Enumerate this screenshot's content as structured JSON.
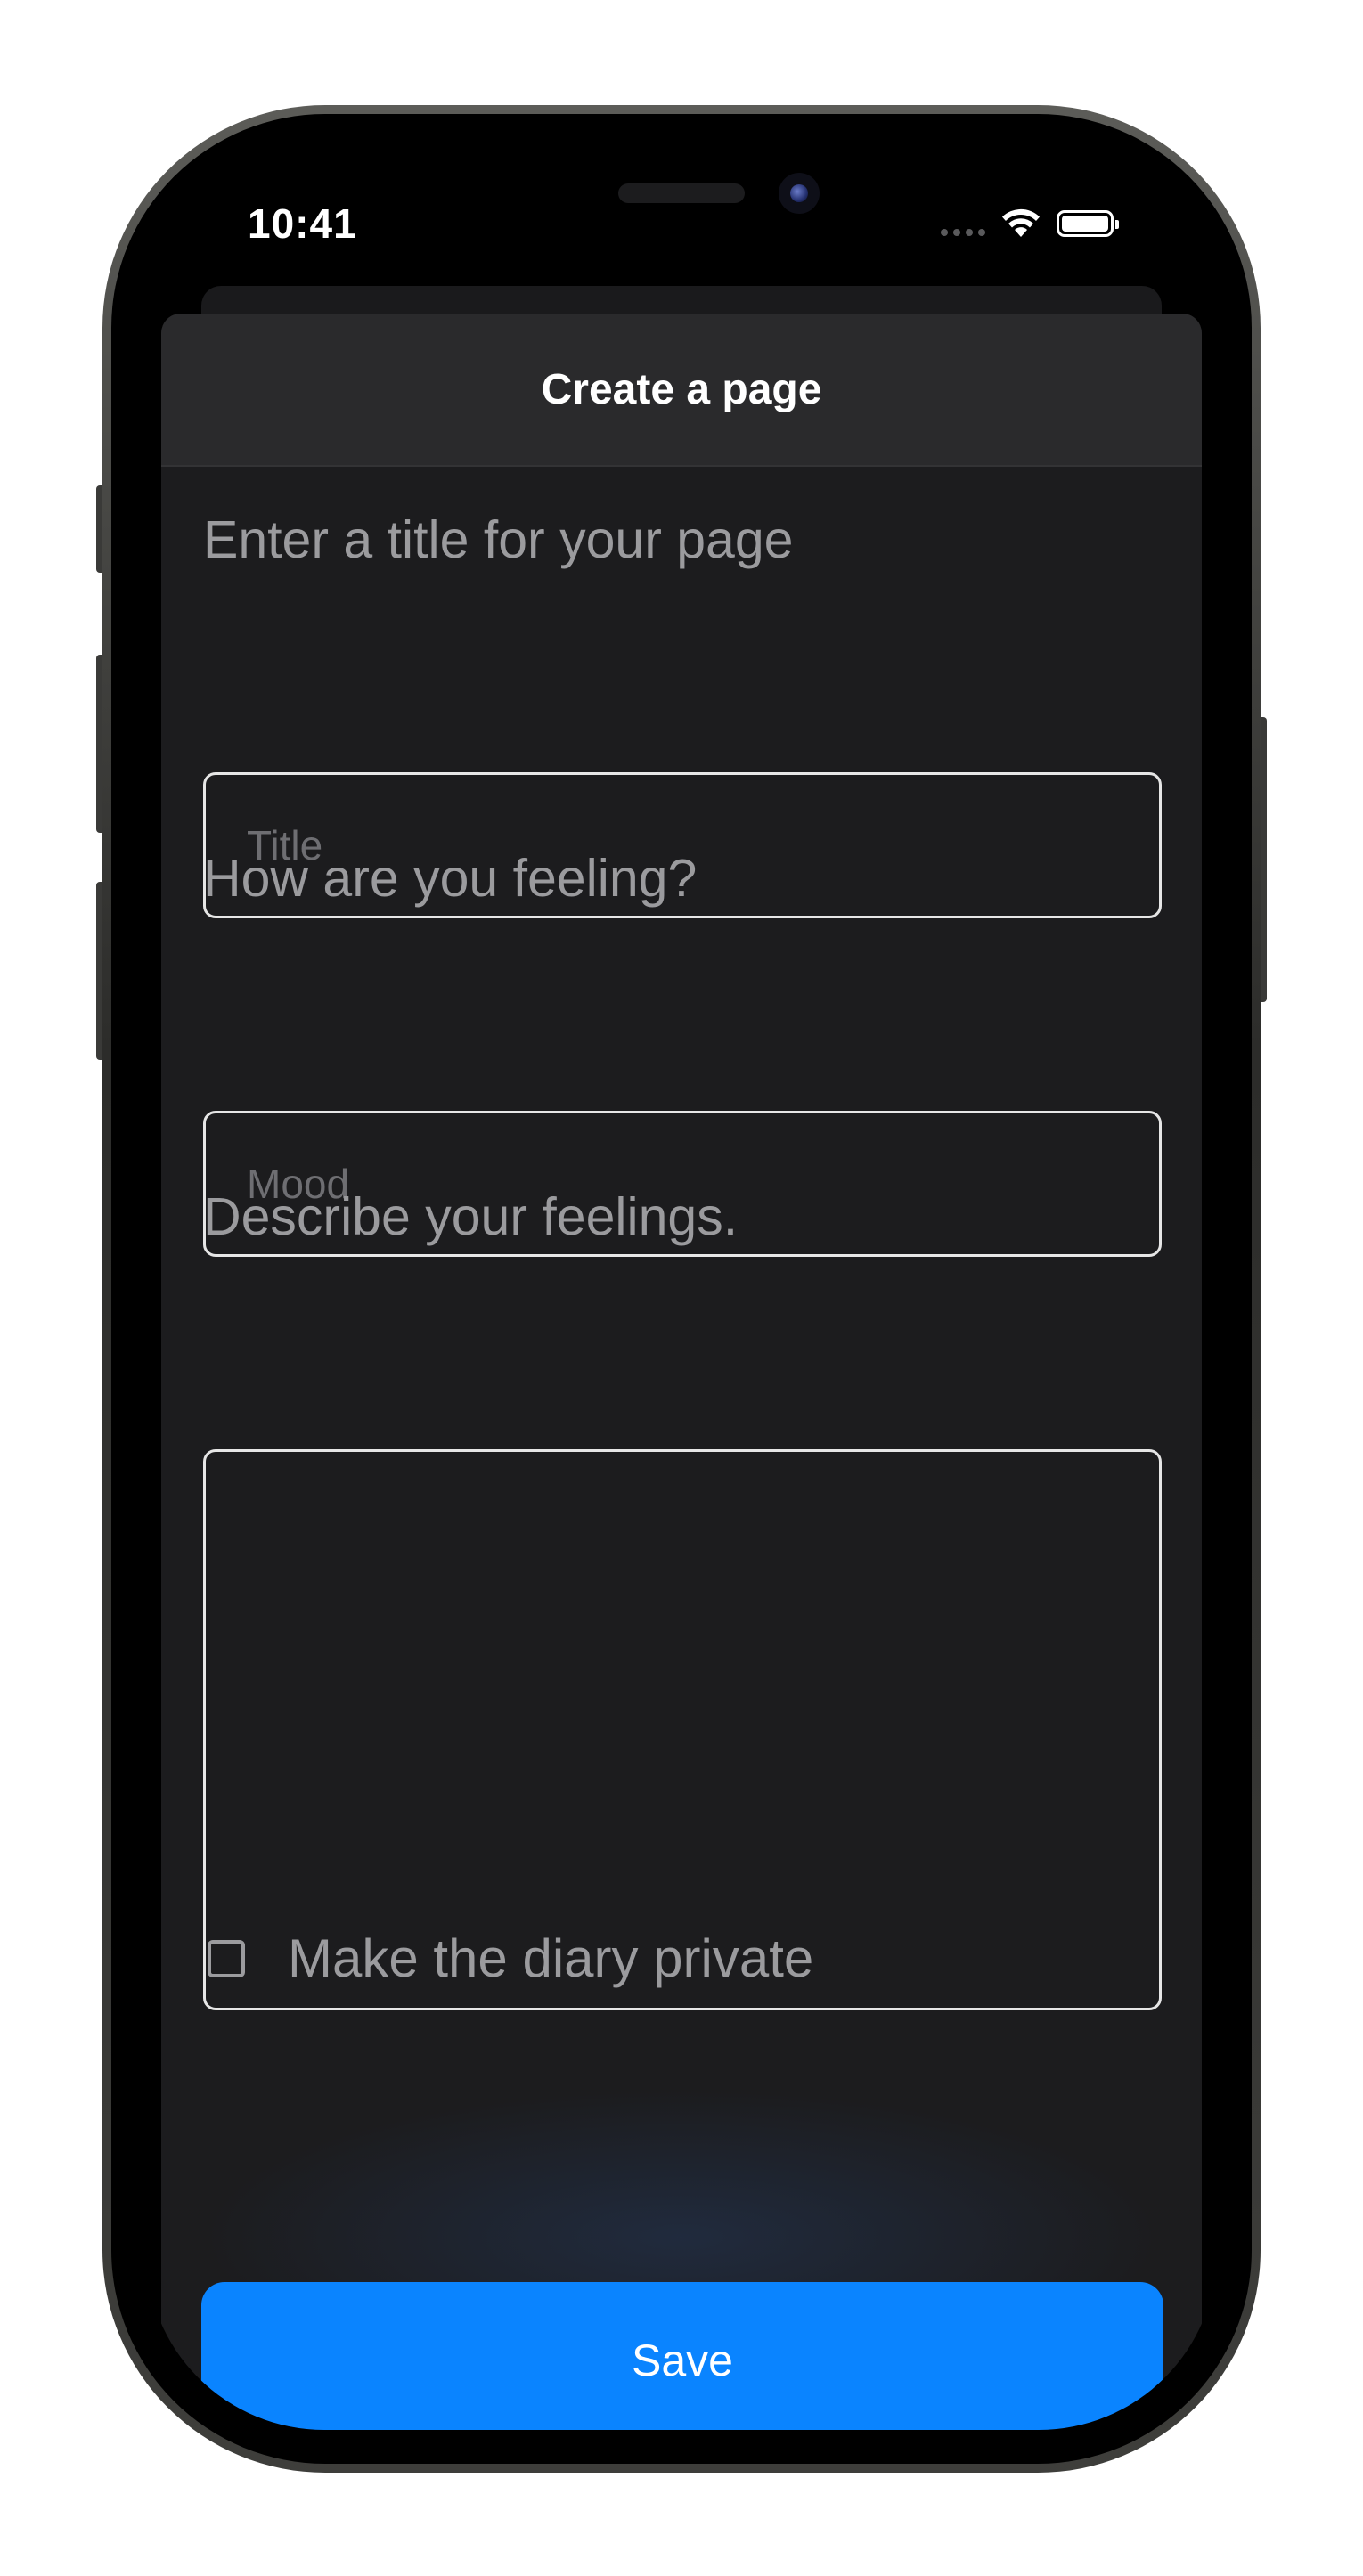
{
  "status_bar": {
    "time": "10:41"
  },
  "sheet": {
    "title": "Create a page"
  },
  "form": {
    "title_label": "Enter a title for your page",
    "title_placeholder": "Title",
    "mood_label": "How are you feeling?",
    "mood_placeholder": "Mood",
    "description_label": "Describe your feelings.",
    "private_label": "Make the diary private",
    "private_checked": false,
    "save_label": "Save"
  },
  "icons": {
    "signal": "cellular-signal-icon",
    "wifi": "wifi-icon",
    "battery": "battery-icon",
    "checkbox": "checkbox-unchecked-icon"
  },
  "colors": {
    "accent": "#0a84ff",
    "sheet_background": "#1c1c1e",
    "header_background": "#2a2a2c",
    "label_text": "#9b9b9e",
    "field_border": "#e6e6e6"
  }
}
